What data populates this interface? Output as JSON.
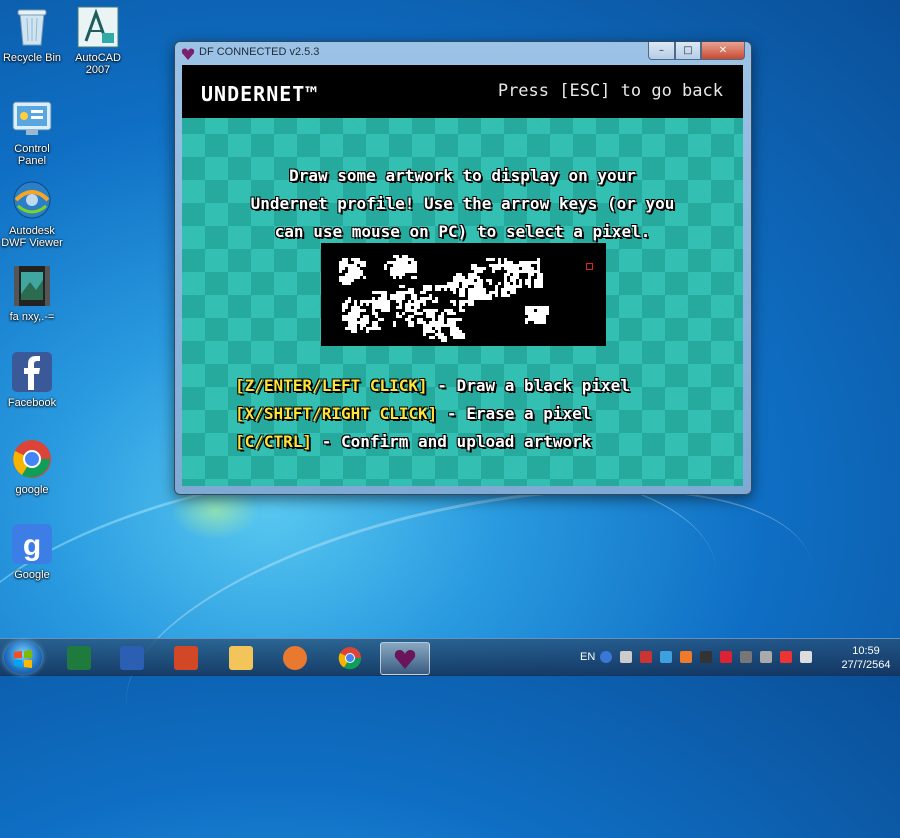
{
  "desktop": {
    "icons": [
      {
        "label": "Recycle Bin"
      },
      {
        "label": "AutoCAD\n2007"
      },
      {
        "label": "Control\nPanel"
      },
      {
        "label": "Autodesk\nDWF Viewer"
      },
      {
        "label": "fa nxy,.-="
      },
      {
        "label": "Facebook"
      },
      {
        "label": "google"
      },
      {
        "label": "Google"
      }
    ]
  },
  "window": {
    "title": "DF CONNECTED v2.5.3",
    "controls": {
      "minimize": "–",
      "maximize": "□",
      "close": "✕"
    }
  },
  "app": {
    "logo": "UNDERNET™",
    "escape_hint": "Press [ESC] to go back",
    "instructions": [
      "Draw some artwork to display on your",
      "Undernet profile! Use the arrow keys (or you",
      "can use mouse on PC) to select a pixel."
    ],
    "key_hints": [
      {
        "key": "[Z/ENTER/LEFT CLICK]",
        "action": " - Draw a black pixel"
      },
      {
        "key": "[X/SHIFT/RIGHT CLICK]",
        "action": " - Erase a pixel"
      },
      {
        "key": "[C/CTRL]",
        "action": " - Confirm and upload artwork"
      }
    ],
    "colors": {
      "accent_teal": "#2ab3a6",
      "key_yellow": "#ffe23a",
      "cursor_red": "#e0202a"
    }
  },
  "taskbar": {
    "apps": [
      "excel-icon",
      "word-icon",
      "powerpoint-icon",
      "explorer-icon",
      "media-player-icon",
      "chrome-icon",
      "deltarune-icon"
    ],
    "language": "EN",
    "time": "10:59",
    "date": "27/7/2564"
  }
}
